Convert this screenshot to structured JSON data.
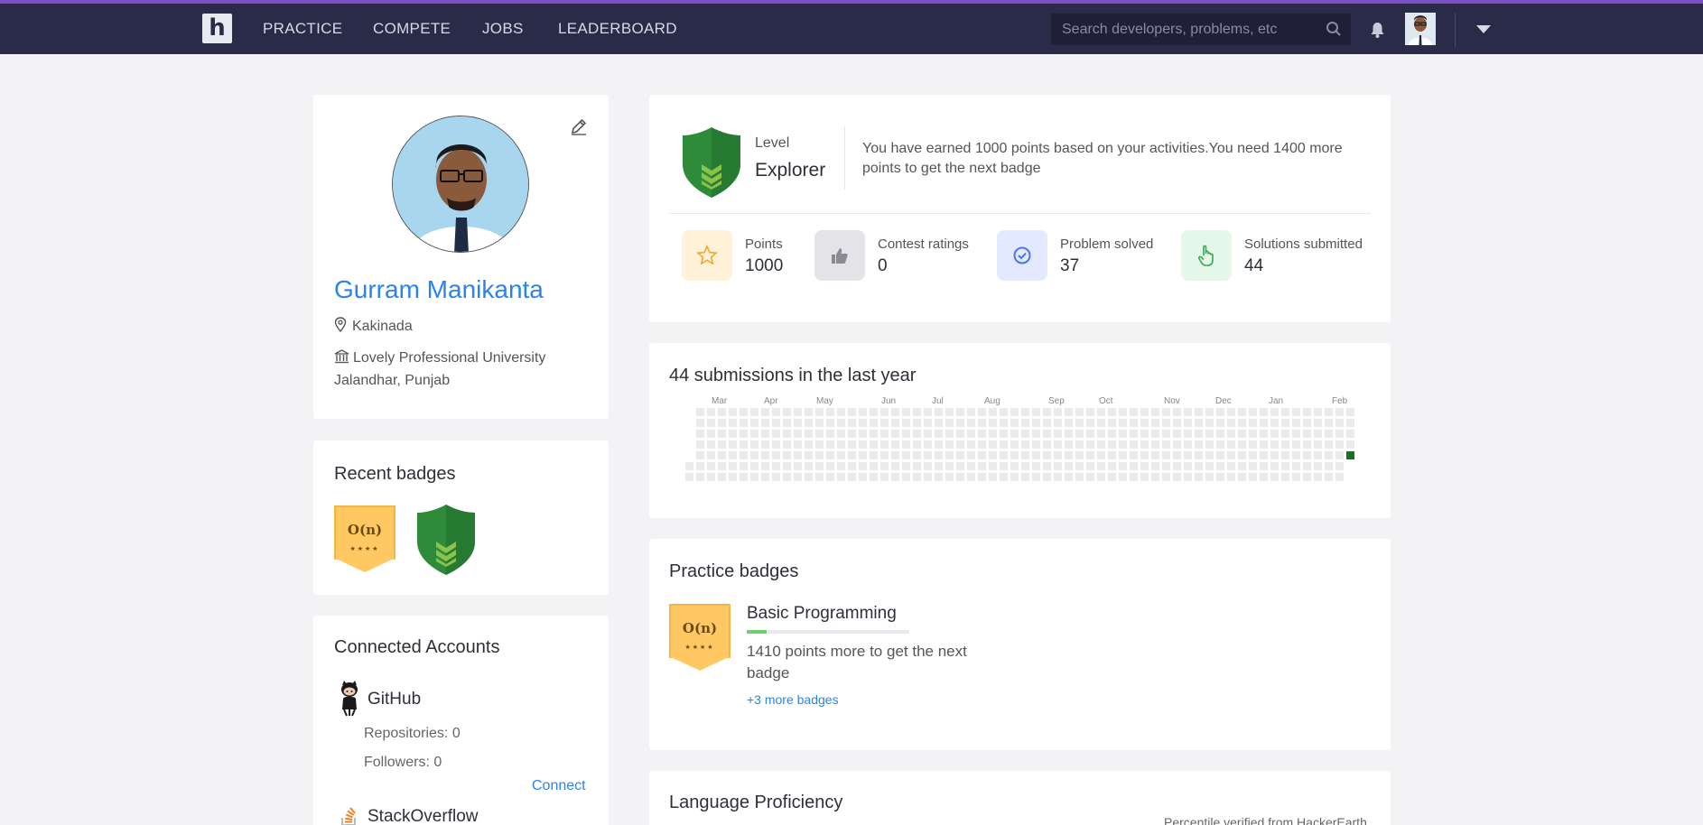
{
  "nav": {
    "logo_letter": "h",
    "items": [
      "PRACTICE",
      "COMPETE",
      "JOBS",
      "LEADERBOARD"
    ],
    "search_placeholder": "Search developers, problems, etc"
  },
  "profile": {
    "name": "Gurram Manikanta",
    "location": "Kakinada",
    "university": "Lovely Professional University Jalandhar, Punjab"
  },
  "recent_badges": {
    "title": "Recent badges",
    "items": [
      {
        "type": "complexity",
        "label": "O(n)",
        "stars": "★★★★"
      },
      {
        "type": "explorer-shield"
      }
    ]
  },
  "connected_accounts": {
    "title": "Connected Accounts",
    "github": {
      "name": "GitHub",
      "repositories": "Repositories: 0",
      "followers": "Followers: 0",
      "connect": "Connect"
    },
    "stackoverflow": {
      "name": "StackOverflow"
    }
  },
  "level": {
    "label": "Level",
    "value": "Explorer",
    "description": "You have earned 1000 points based on your activities.You need 1400 more points to get the next badge"
  },
  "stats": [
    {
      "label": "Points",
      "value": "1000",
      "icon": "star-icon",
      "color": "#fff2d9"
    },
    {
      "label": "Contest ratings",
      "value": "0",
      "icon": "thumbs-up-icon",
      "color": "#e4e4e8"
    },
    {
      "label": "Problem solved",
      "value": "37",
      "icon": "check-circle-icon",
      "color": "#e3e9ff"
    },
    {
      "label": "Solutions submitted",
      "value": "44",
      "icon": "pointer-hand-icon",
      "color": "#e4f7e8"
    }
  ],
  "submissions": {
    "title": "44 submissions in the last year",
    "months": [
      "Mar",
      "Apr",
      "May",
      "Jun",
      "Jul",
      "Aug",
      "Sep",
      "Oct",
      "Nov",
      "Dec",
      "Jan",
      "Feb"
    ],
    "active_cell_color": "#1f6b2a",
    "empty_cell_color": "#ebebed"
  },
  "practice_badges": {
    "title": "Practice badges",
    "badge_label": "O(n)",
    "badge_stars": "★★★★",
    "name": "Basic Programming",
    "progress": 0.12,
    "description": "1410 points more to get the next badge",
    "more_link": "+3 more badges"
  },
  "language": {
    "title": "Language Proficiency",
    "note": "Percentile verified from HackerEarth"
  },
  "colors": {
    "navbar": "#2a2b48",
    "accent_top": "#7c4fc4",
    "link": "#2b83f0",
    "badge_green": "#2e8b3a"
  }
}
